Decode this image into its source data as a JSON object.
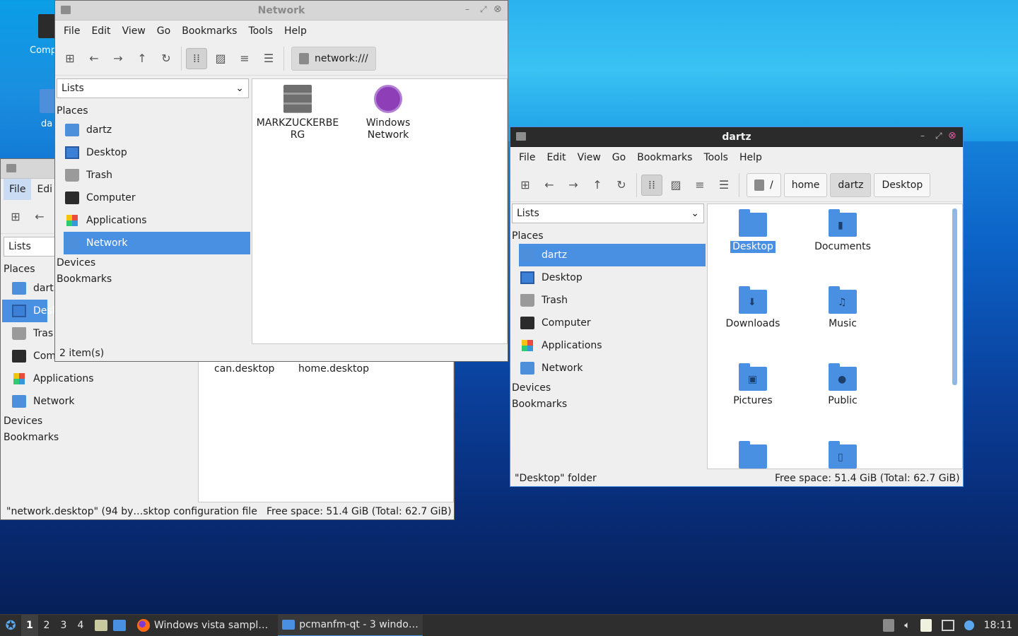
{
  "desktop": {
    "icons": [
      {
        "label": "Comp"
      },
      {
        "label": "da"
      }
    ]
  },
  "menu": [
    "File",
    "Edit",
    "View",
    "Go",
    "Bookmarks",
    "Tools",
    "Help"
  ],
  "places_combo": "Lists",
  "sections": {
    "places": "Places",
    "devices": "Devices",
    "bookmarks": "Bookmarks"
  },
  "network_window": {
    "title": "Network",
    "path": "network:///",
    "places": [
      "dartz",
      "Desktop",
      "Trash",
      "Computer",
      "Applications",
      "Network"
    ],
    "items": [
      {
        "label": "MARKZUCKERBE RG"
      },
      {
        "label": "Windows Network"
      }
    ],
    "status": "2 item(s)"
  },
  "back_window": {
    "menu_file": "File",
    "menu_edit": "Edi",
    "places_combo": "Lists",
    "places": [
      "dart",
      "Desk",
      "Tras",
      "Com",
      "Applications",
      "Network"
    ],
    "files": [
      "can.desktop",
      "home.desktop"
    ],
    "status_left": "\"network.desktop\" (94 by…sktop configuration file",
    "status_right": "Free space: 51.4 GiB (Total: 62.7 GiB)"
  },
  "dartz_window": {
    "title": "dartz",
    "crumbs": [
      "/",
      "home",
      "dartz",
      "Desktop"
    ],
    "places": [
      "dartz",
      "Desktop",
      "Trash",
      "Computer",
      "Applications",
      "Network"
    ],
    "items": [
      {
        "label": "Desktop",
        "glyph": ""
      },
      {
        "label": "Documents",
        "glyph": "▮"
      },
      {
        "label": "Downloads",
        "glyph": "⬇"
      },
      {
        "label": "Music",
        "glyph": "♫"
      },
      {
        "label": "Pictures",
        "glyph": "▣"
      },
      {
        "label": "Public",
        "glyph": "●"
      },
      {
        "label": "",
        "glyph": ""
      },
      {
        "label": "",
        "glyph": "▯"
      }
    ],
    "status_left": "\"Desktop\" folder",
    "status_right": "Free space: 51.4 GiB (Total: 62.7 GiB)"
  },
  "taskbar": {
    "workspaces": [
      "1",
      "2",
      "3",
      "4"
    ],
    "tasks": [
      {
        "label": "Windows vista sampl…"
      },
      {
        "label": "pcmanfm-qt - 3 windo…"
      }
    ],
    "clock": "18:11"
  },
  "colors": {
    "accent": "#4a90e2",
    "titlebar_dark": "#2b2b2b",
    "taskbar": "#2e2e2e"
  }
}
